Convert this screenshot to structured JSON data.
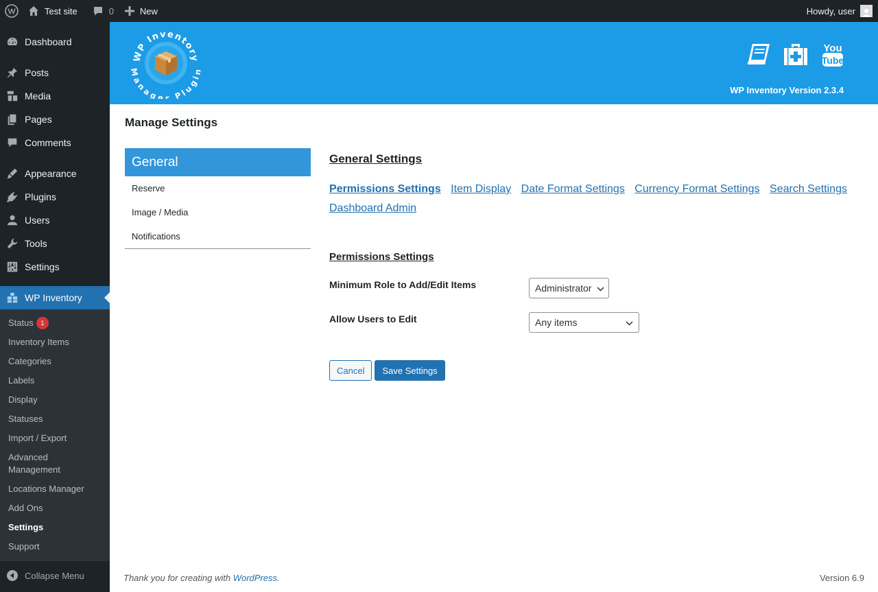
{
  "adminbar": {
    "site_name": "Test site",
    "comments_count": "0",
    "new_label": "New",
    "howdy": "Howdy, user"
  },
  "sidebar": {
    "items": [
      {
        "label": "Dashboard",
        "icon": "dashboard-icon"
      },
      {
        "label": "Posts",
        "icon": "pin-icon"
      },
      {
        "label": "Media",
        "icon": "media-icon"
      },
      {
        "label": "Pages",
        "icon": "pages-icon"
      },
      {
        "label": "Comments",
        "icon": "comment-icon"
      },
      {
        "label": "Appearance",
        "icon": "brush-icon"
      },
      {
        "label": "Plugins",
        "icon": "plug-icon"
      },
      {
        "label": "Users",
        "icon": "user-icon"
      },
      {
        "label": "Tools",
        "icon": "wrench-icon"
      },
      {
        "label": "Settings",
        "icon": "sliders-icon"
      },
      {
        "label": "WP Inventory",
        "icon": "boxes-icon"
      }
    ],
    "submenu": [
      {
        "label": "Status",
        "badge": "1"
      },
      {
        "label": "Inventory Items"
      },
      {
        "label": "Categories"
      },
      {
        "label": "Labels"
      },
      {
        "label": "Display"
      },
      {
        "label": "Statuses"
      },
      {
        "label": "Import / Export"
      },
      {
        "label": "Advanced Management"
      },
      {
        "label": "Locations Manager"
      },
      {
        "label": "Add Ons"
      },
      {
        "label": "Settings"
      },
      {
        "label": "Support"
      }
    ],
    "collapse_label": "Collapse Menu"
  },
  "header": {
    "logo_text_top": "WP Inventory",
    "logo_text_bottom": "Manager Plugin",
    "version": "WP Inventory Version 2.3.4",
    "colors": {
      "banner": "#1c9be6"
    }
  },
  "page": {
    "title": "Manage Settings",
    "settings_nav": {
      "active": "General",
      "items": [
        "Reserve",
        "Image / Media",
        "Notifications"
      ]
    },
    "panel": {
      "heading": "General Settings",
      "links": [
        "Permissions Settings",
        "Item Display",
        "Date Format Settings",
        "Currency Format Settings",
        "Search Settings",
        "Dashboard Admin"
      ],
      "section_heading": "Permissions Settings",
      "fields": [
        {
          "label": "Minimum Role to Add/Edit Items",
          "value": "Administrator"
        },
        {
          "label": "Allow Users to Edit",
          "value": "Any items"
        }
      ],
      "cancel_label": "Cancel",
      "save_label": "Save Settings"
    }
  },
  "footer": {
    "thanks_prefix": "Thank you for creating with ",
    "thanks_link": "WordPress",
    "thanks_suffix": ".",
    "version": "Version 6.9"
  }
}
